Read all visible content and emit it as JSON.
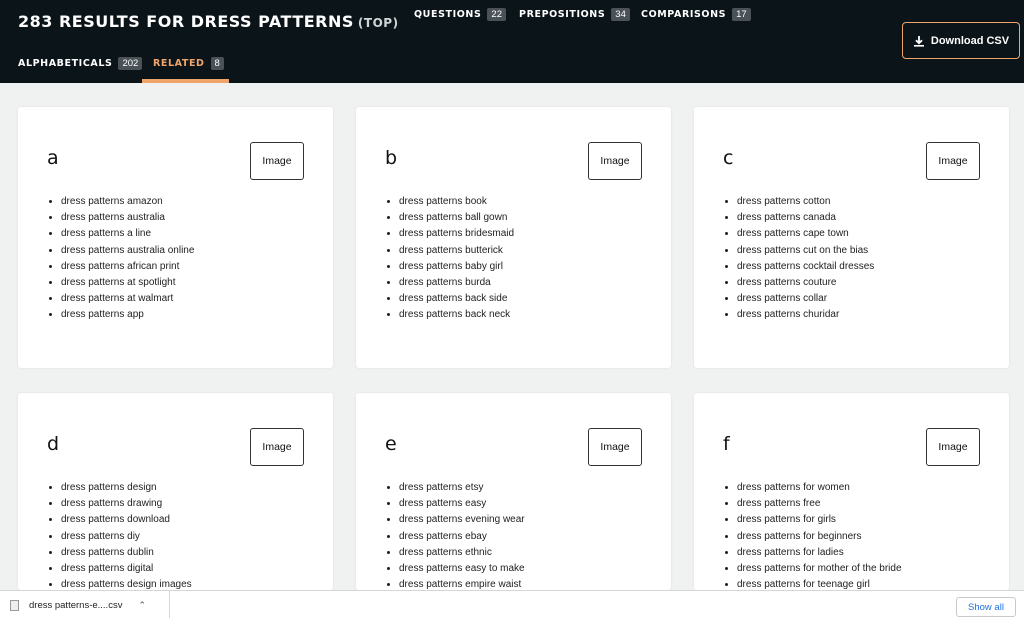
{
  "header": {
    "title": "283 RESULTS FOR DRESS PATTERNS",
    "subtitle": "(TOP)",
    "tabs": [
      {
        "label": "QUESTIONS",
        "count": "22"
      },
      {
        "label": "PREPOSITIONS",
        "count": "34"
      },
      {
        "label": "COMPARISONS",
        "count": "17"
      },
      {
        "label": "ALPHABETICALS",
        "count": "202"
      },
      {
        "label": "RELATED",
        "count": "8"
      }
    ],
    "download_label": "Download CSV",
    "accent_color": "#f0a46a"
  },
  "cards": [
    {
      "letter": "a",
      "button": "Image",
      "items": [
        "dress patterns amazon",
        "dress patterns australia",
        "dress patterns a line",
        "dress patterns australia online",
        "dress patterns african print",
        "dress patterns at spotlight",
        "dress patterns at walmart",
        "dress patterns app"
      ]
    },
    {
      "letter": "b",
      "button": "Image",
      "items": [
        "dress patterns book",
        "dress patterns ball gown",
        "dress patterns bridesmaid",
        "dress patterns butterick",
        "dress patterns baby girl",
        "dress patterns burda",
        "dress patterns back side",
        "dress patterns back neck"
      ]
    },
    {
      "letter": "c",
      "button": "Image",
      "items": [
        "dress patterns cotton",
        "dress patterns canada",
        "dress patterns cape town",
        "dress patterns cut on the bias",
        "dress patterns cocktail dresses",
        "dress patterns couture",
        "dress patterns collar",
        "dress patterns churidar"
      ]
    },
    {
      "letter": "d",
      "button": "Image",
      "items": [
        "dress patterns design",
        "dress patterns drawing",
        "dress patterns download",
        "dress patterns diy",
        "dress patterns dublin",
        "dress patterns digital",
        "dress patterns design images"
      ]
    },
    {
      "letter": "e",
      "button": "Image",
      "items": [
        "dress patterns etsy",
        "dress patterns easy",
        "dress patterns evening wear",
        "dress patterns ebay",
        "dress patterns ethnic",
        "dress patterns easy to make",
        "dress patterns empire waist"
      ]
    },
    {
      "letter": "f",
      "button": "Image",
      "items": [
        "dress patterns for women",
        "dress patterns free",
        "dress patterns for girls",
        "dress patterns for beginners",
        "dress patterns for ladies",
        "dress patterns for mother of the bride",
        "dress patterns for teenage girl"
      ]
    }
  ],
  "download_bar": {
    "file_name": "dress patterns-e....csv",
    "show_all": "Show all"
  }
}
